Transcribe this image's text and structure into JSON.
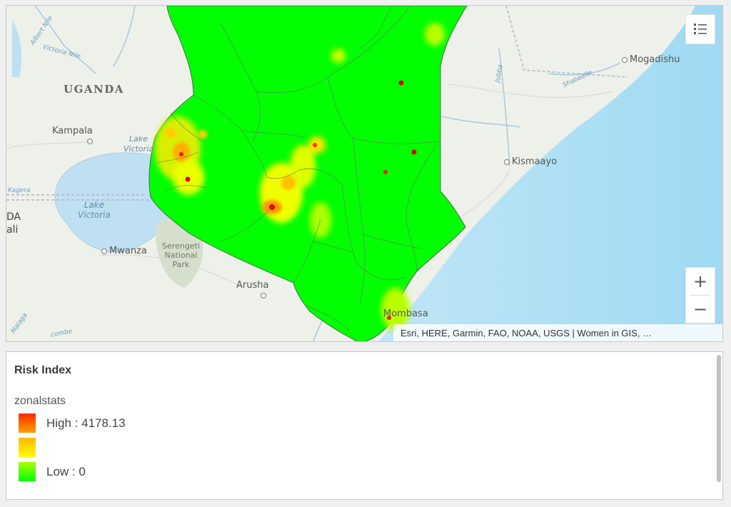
{
  "map": {
    "places": {
      "uganda": "UGANDA",
      "kampala": "Kampala",
      "mogadishu": "Mogadishu",
      "kismaayo": "Kismaayo",
      "mwanza": "Mwanza",
      "arusha": "Arusha",
      "mombasa": "Mombasa",
      "lake_victoria": "Lake\nVictoria",
      "lake_victoria_small": "Lake\nVictoria",
      "serengeti": "Serengeti\nNational\nPark",
      "albert_nile": "Albert Nile",
      "victoria_nile": "Victoria Nile",
      "jubba": "Jubba",
      "shabeelle": "Shabeelle",
      "partial_left_1": "DA",
      "partial_left_2": "ali",
      "partial_kagera": "Kagera",
      "partial_malagarasi": "Malaga",
      "partial_combe": "combe"
    },
    "attribution": "Esri, HERE, Garmin, FAO, NOAA, USGS | Women in GIS, …",
    "icons": {
      "legend_toggle": "legend-icon",
      "zoom_in": "+",
      "zoom_out": "−"
    },
    "colors": {
      "low": "#00ff00",
      "mid": "#ffff00",
      "high": "#ff0000",
      "land": "#eef0ea",
      "ocean": "#bfe6f5",
      "park": "#d6dfcc"
    }
  },
  "legend": {
    "title": "Risk Index",
    "layer": "zonalstats",
    "items": [
      {
        "label": "High : 4178.13",
        "gradient": [
          "#ff2a00",
          "#ffa000"
        ]
      },
      {
        "label": "",
        "gradient": [
          "#ffb800",
          "#ffff00"
        ]
      },
      {
        "label": "Low : 0",
        "gradient": [
          "#aaff00",
          "#00ff00"
        ]
      }
    ]
  }
}
